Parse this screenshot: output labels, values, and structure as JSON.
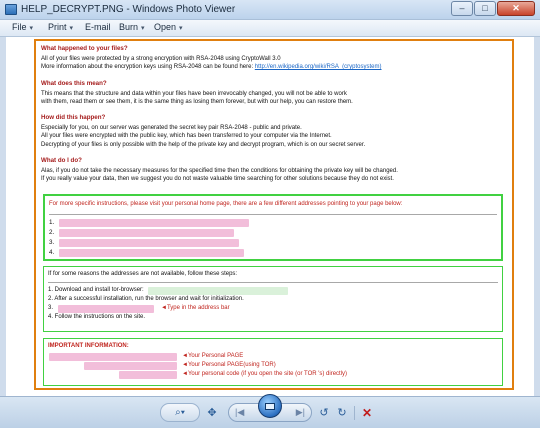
{
  "window": {
    "title": "HELP_DECRYPT.PNG - Windows Photo Viewer",
    "minimize_label": "–",
    "maximize_label": "□",
    "close_label": "✕"
  },
  "menu": {
    "file": "File",
    "print": "Print",
    "email": "E-mail",
    "burn": "Burn",
    "open": "Open",
    "arrow": "▾"
  },
  "document": {
    "q1_title": "What happened to your files?",
    "q1_line1": "All of your files were protected by a strong encryption with RSA-2048 using CryptoWall 3.0",
    "q1_line2_prefix": "More information about the encryption keys using RSA-2048 can be found here: ",
    "q1_link": "http://en.wikipedia.org/wiki/RSA_(cryptosystem)",
    "q2_title": "What does this mean?",
    "q2_line1": "This means that the structure and data within your files have been irrevocably changed, you will not be able to work",
    "q2_line2": "with them, read them or see them, it is the same thing as losing them forever, but with our help, you can restore them.",
    "q3_title": "How did this happen?",
    "q3_line1": "Especially for you, on our server was generated the secret key pair RSA-2048 - public and private.",
    "q3_line2": "All your files were encrypted with the public key, which has been transferred to your computer via the Internet.",
    "q3_line3": "Decrypting of your files is only possible with the help of the private key and decrypt program, which is on our secret server.",
    "q4_title": "What do I do?",
    "q4_line1": "Alas, if you do not take the necessary measures for the specified time then the conditions for obtaining the private key will be changed.",
    "q4_line2": "If you really value your data, then we suggest you do not waste valuable time searching for other solutions because they do not exist."
  },
  "box1": {
    "intro": "For more specific instructions, please visit your personal home page, there are a few different addresses pointing to your page below:",
    "items": [
      "1.",
      "2.",
      "3.",
      "4."
    ]
  },
  "box2": {
    "intro": "If for some reasons the addresses are not available, follow these steps:",
    "step1": "1. Download and install tor-browser:",
    "step2": "2. After a successful installation, run the browser and wait for initialization.",
    "step3": "3.",
    "step3_note": "◄Type in the address bar",
    "step4": "4. Follow the instructions on the site."
  },
  "box3": {
    "title": "IMPORTANT INFORMATION:",
    "note1": "◄Your Personal PAGE",
    "note2": "◄Your Personal PAGE(using TOR)",
    "note3": "◄Your personal code (if you open the site (or TOR 's) directly)"
  },
  "toolbar": {
    "zoom_icon": "⌕▾",
    "fit_icon": "✥",
    "prev_icon": "|◀",
    "next_icon": "▶|",
    "rotate_ccw_icon": "↺",
    "rotate_cw_icon": "↻",
    "delete_icon": "✕"
  }
}
